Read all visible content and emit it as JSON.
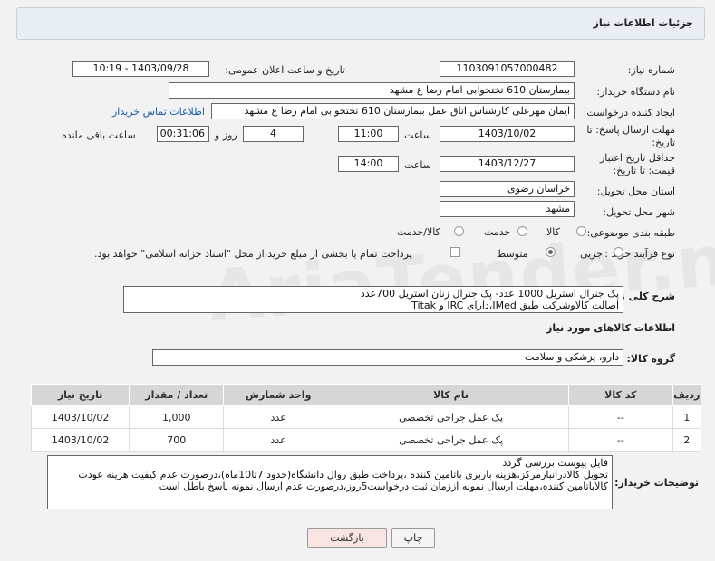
{
  "header": {
    "title": "جزئیات اطلاعات نیاز"
  },
  "watermark": "AriaTender.net",
  "form": {
    "need_number_label": "شماره نیاز:",
    "need_number": "1103091057000482",
    "announce_label": "تاریخ و ساعت اعلان عمومی:",
    "announce_value": "1403/09/28 - 10:19",
    "buyer_org_label": "نام دستگاه خریدار:",
    "buyer_org": "بیمارستان 610 تختخوابی امام رضا ع  مشهد",
    "creator_label": "ایجاد کننده درخواست:",
    "creator": "ایمان مهرعلی کارشناس اتاق عمل بیمارستان 610 تختخوابی امام رضا ع  مشهد",
    "contact_link": "اطلاعات تماس خریدار",
    "deadline_label": "مهلت ارسال پاسخ: تا تاریخ:",
    "deadline_date": "1403/10/02",
    "time_label": "ساعت",
    "deadline_time": "11:00",
    "days_value": "4",
    "days_label": "روز و",
    "remaining_time": "00:31:06",
    "remaining_label": "ساعت باقی مانده",
    "price_valid_label": "حداقل تاریخ اعتبار قیمت: تا تاریخ:",
    "price_valid_date": "1403/12/27",
    "price_valid_time": "14:00",
    "province_label": "استان محل تحویل:",
    "province": "خراسان رضوی",
    "city_label": "شهر محل تحویل:",
    "city": "مشهد",
    "category_label": "طبقه بندی موضوعی:",
    "category_options": [
      "کالا",
      "خدمت",
      "کالا/خدمت"
    ],
    "process_label": "نوع فرآیند خرید :",
    "process_options": [
      "جزیی",
      "متوسط"
    ],
    "payment_note": "پرداخت تمام یا بخشی از مبلغ خرید،از محل \"اسناد خزانه اسلامی\" خواهد بود.",
    "summary_label": "شرح کلی نیاز:",
    "summary": "پک جنرال استریل 1000 عدد- پک جنرال زنان استریل 700عدد\nاصالت کالاوشرکت طبق IMed،دارای IRC و Titak",
    "goods_info_title": "اطلاعات کالاهای مورد نیاز",
    "goods_group_label": "گروه کالا:",
    "goods_group": "دارو، پزشکی و سلامت",
    "buyer_notes_label": "توضیحات خریدار:",
    "buyer_notes": "فایل پیوست بررسی گردد\nتحویل کالادرانبارمرکز،هزینه باربری باتامین کننده ،پرداخت طبق روال دانشگاه(حدود 7تا10ماه)،درصورت عدم کیفیت هزینه عودت کالاباتامین کننده،مهلت ارسال نمونه اززمان ثبت درخواست5روز،درصورت عدم ارسال نمونه پاسخ باطل است"
  },
  "table": {
    "headers": [
      "ردیف",
      "کد کالا",
      "نام کالا",
      "واحد شمارش",
      "تعداد / مقدار",
      "تاریخ نیاز"
    ],
    "rows": [
      [
        "1",
        "--",
        "پک عمل جراحی تخصصی",
        "عدد",
        "1,000",
        "1403/10/02"
      ],
      [
        "2",
        "--",
        "پک عمل جراحی تخصصی",
        "عدد",
        "700",
        "1403/10/02"
      ]
    ]
  },
  "buttons": {
    "print": "چاپ",
    "back": "بازگشت"
  }
}
